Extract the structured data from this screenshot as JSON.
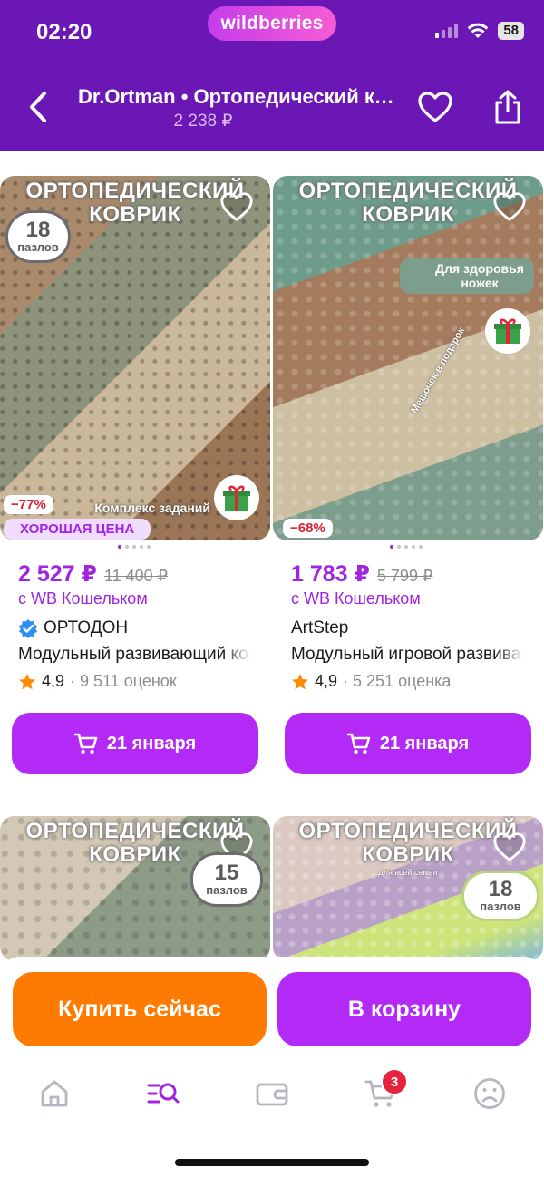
{
  "status": {
    "time": "02:20",
    "battery": "58"
  },
  "brand": {
    "logo": "wildberries"
  },
  "header": {
    "title": "Dr.Ortman • Ортопедический коврик",
    "price": "2 238 ₽"
  },
  "products": [
    {
      "img_title": "ОРТОПЕДИЧЕСКИЙ КОВРИК",
      "pieces_n": "18",
      "pieces_u": "пазлов",
      "complex_text": "Комплекс заданий",
      "discount": "−77%",
      "good_price": "ХОРОШАЯ ЦЕНА",
      "price": "2 527 ₽",
      "old_price": "11 400 ₽",
      "wallet": "с WB Кошельком",
      "seller": "ОРТОДОН",
      "name": "Модульный развивающий коврик",
      "rating": "4,9",
      "reviews": "· 9 511 оценок",
      "delivery": "21 января"
    },
    {
      "img_title": "ОРТОПЕДИЧЕСКИЙ КОВРИК",
      "health": "Для здоровья ножек",
      "gift_caption": "Мешочек в подарок",
      "discount": "−68%",
      "price": "1 783 ₽",
      "old_price": "5 799 ₽",
      "wallet": "с WB Кошельком",
      "seller": "ArtStep",
      "name": "Модульный игровой развивающий",
      "rating": "4,9",
      "reviews": "· 5 251 оценка",
      "delivery": "21 января"
    },
    {
      "img_title": "ОРТОПЕДИЧЕСКИЙ КОВРИК",
      "pieces_n": "15",
      "pieces_u": "пазлов"
    },
    {
      "img_title": "ОРТОПЕДИЧЕСКИЙ КОВРИК",
      "img_sub": "для всей семьи",
      "pieces_n": "18",
      "pieces_u": "пазлов"
    }
  ],
  "actions": {
    "buy_now": "Купить сейчас",
    "add_to_cart": "В корзину"
  },
  "tabbar": {
    "cart_count": "3"
  },
  "colors": {
    "brand_purple": "#6a17b5",
    "accent": "#b32af6",
    "orange": "#ff7a00",
    "price": "#a024e0",
    "discount_red": "#d5243a"
  }
}
